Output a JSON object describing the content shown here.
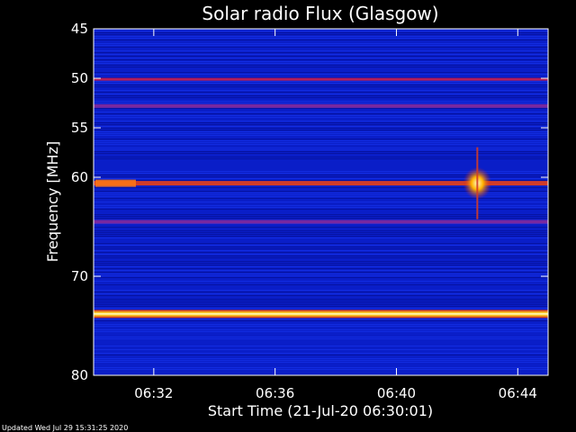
{
  "chart_data": {
    "type": "heatmap",
    "title": "Solar radio Flux (Glasgow)",
    "xlabel": "Start Time (21-Jul-20 06:30:01)",
    "ylabel": "Frequency [MHz]",
    "x_range": [
      "06:30:01",
      "06:45:00"
    ],
    "y_range": [
      45,
      80
    ],
    "x_ticks": [
      "06:32",
      "06:36",
      "06:40",
      "06:44"
    ],
    "y_ticks": [
      "45",
      "50",
      "55",
      "60",
      "70",
      "80"
    ],
    "y_tick_values": [
      45,
      50,
      55,
      60,
      70,
      80
    ],
    "colormap": "blue-red-yellow-white",
    "features": [
      {
        "kind": "band",
        "freq_mhz": 50.1,
        "level": "red"
      },
      {
        "kind": "band",
        "freq_mhz": 52.8,
        "level": "purple"
      },
      {
        "kind": "band",
        "freq_mhz": 60.6,
        "level": "red-orange"
      },
      {
        "kind": "band",
        "freq_mhz": 64.5,
        "level": "purple"
      },
      {
        "kind": "band",
        "freq_mhz": 73.8,
        "level": "yellow-white"
      },
      {
        "kind": "burst",
        "time": "06:42:40",
        "freq_mhz": 60.6,
        "level": "yellow"
      }
    ]
  },
  "footer": {
    "updated": "Updated Wed Jul 29 15:31:25 2020"
  },
  "colors": {
    "background": "#000000",
    "plot_base": "#0a1ec8",
    "axis": "#ffffff"
  }
}
